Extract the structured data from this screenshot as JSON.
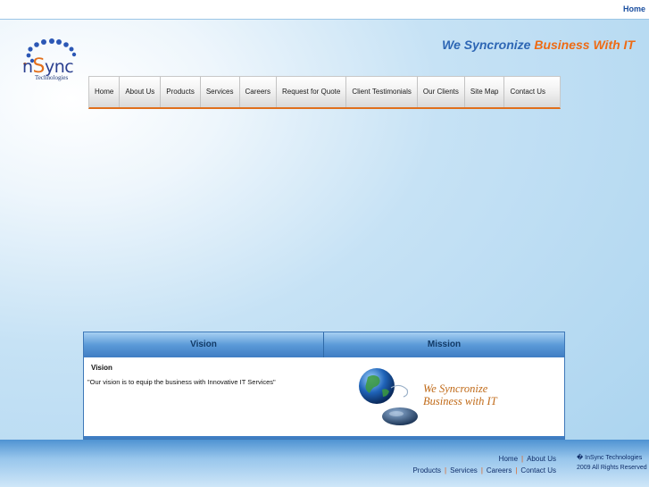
{
  "topbar": {
    "home_label": "Home"
  },
  "logo": {
    "brand_prefix": "n",
    "brand_s": "S",
    "brand_suffix": "ync",
    "subtitle": "Technologies"
  },
  "tagline": {
    "part1": "We Syncronize ",
    "part2": "Business With IT"
  },
  "nav": {
    "items": [
      "Home",
      "About Us",
      "Products",
      "Services",
      "Careers",
      "Request for Quote",
      "Client Testimonials",
      "Our Clients",
      "Site Map",
      "Contact Us"
    ]
  },
  "panel": {
    "vision_header": "Vision",
    "mission_header": "Mission",
    "vision_title": "Vision",
    "vision_text": "\"Our vision is to equip the business with Innovative IT Services\"",
    "image_line1": "We Syncronize",
    "image_line2": "Business with IT"
  },
  "footer": {
    "links_row1": [
      "Home",
      "About Us"
    ],
    "links_row2": [
      "Products",
      "Services",
      "Careers",
      "Contact Us"
    ],
    "separator": "|",
    "copyright": "�  InSync Technologies 2009 All Rights Reserved"
  },
  "colors": {
    "accent_orange": "#e06f1c",
    "brand_blue": "#2d66b4",
    "header_blue": "#3f7dc3"
  }
}
